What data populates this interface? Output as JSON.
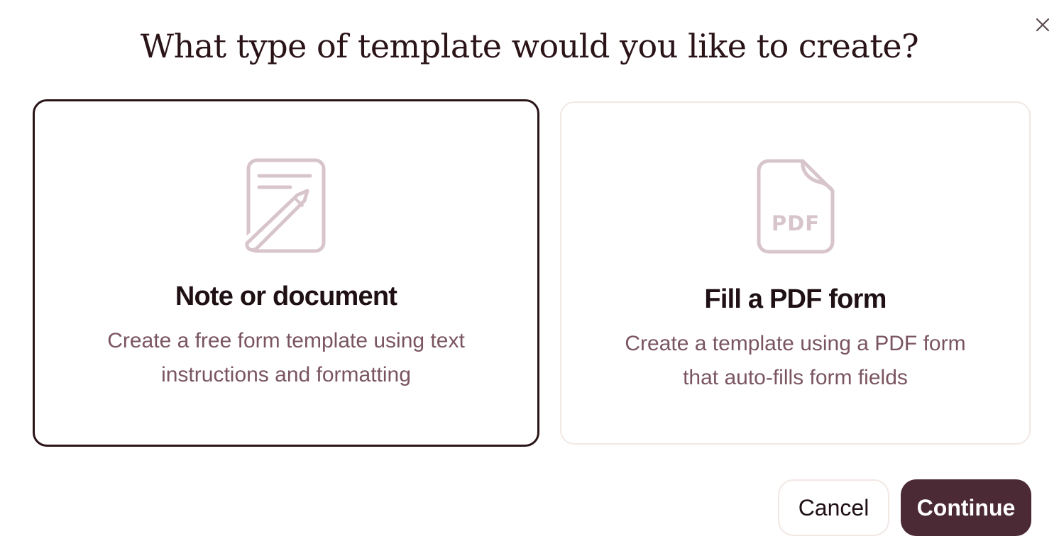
{
  "dialog": {
    "title": "What type of template would you like to create?",
    "close_icon": "close-icon"
  },
  "options": [
    {
      "title": "Note or document",
      "description": "Create a free form template using text instructions and formatting",
      "icon": "document-pencil-icon",
      "selected": true
    },
    {
      "title": "Fill a PDF form",
      "description": "Create a template using a PDF form that auto-fills form fields",
      "icon": "pdf-file-icon",
      "icon_text": "PDF",
      "selected": false
    }
  ],
  "actions": {
    "cancel_label": "Cancel",
    "continue_label": "Continue"
  },
  "colors": {
    "primary": "#4c2a35",
    "title_text": "#2a1418",
    "secondary_text": "#7a5560",
    "icon": "#d8c5cb",
    "border_light": "#f1e8e4"
  }
}
